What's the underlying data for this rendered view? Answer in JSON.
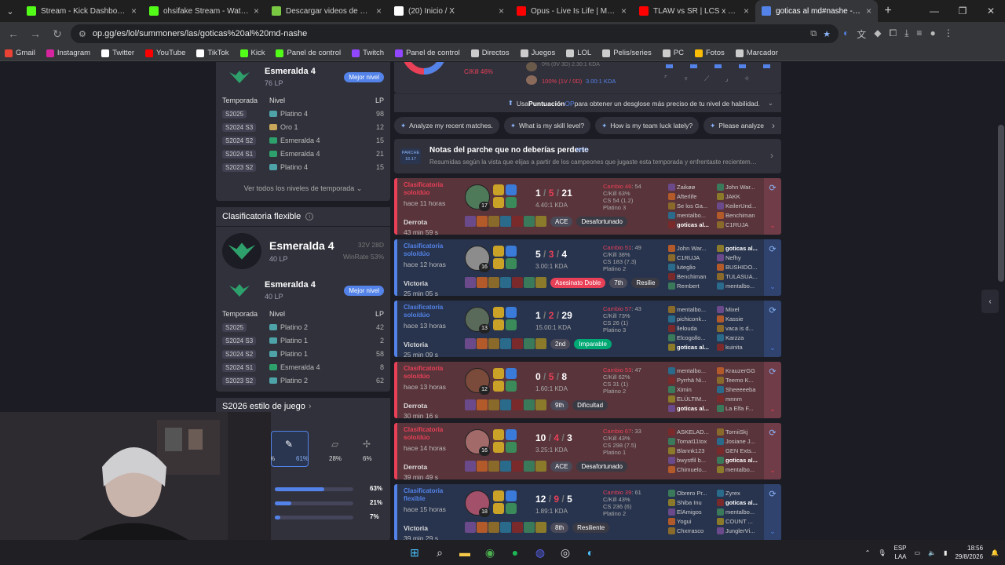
{
  "tabs": [
    {
      "label": "Stream - Kick Dashboard",
      "color": "#53fc18",
      "active": false
    },
    {
      "label": "ohsifake Stream - Watch Live on Kick",
      "color": "#53fc18",
      "active": false
    },
    {
      "label": "Descargar videos de YouTube",
      "color": "#7ac943",
      "active": false
    },
    {
      "label": "(20) Inicio / X",
      "color": "#ffffff",
      "active": false
    },
    {
      "label": "Opus - Live Is Life | Maradona C",
      "color": "#ff0000",
      "active": false
    },
    {
      "label": "TLAW vs SR | LCS x LOL ESPORTS",
      "color": "#ff0000",
      "active": false
    },
    {
      "label": "goticas al md#nashe - Estadísticas",
      "color": "#5383e8",
      "active": true
    }
  ],
  "address": {
    "url": "op.gg/es/lol/summoners/las/goticas%20al%20md-nashe"
  },
  "bookmarks": [
    {
      "label": "Gmail",
      "color": "#ea4335"
    },
    {
      "label": "Instagram",
      "color": "#d6249f"
    },
    {
      "label": "Twitter",
      "color": "#ffffff"
    },
    {
      "label": "YouTube",
      "color": "#ff0000"
    },
    {
      "label": "TikTok",
      "color": "#ffffff"
    },
    {
      "label": "Kick",
      "color": "#53fc18"
    },
    {
      "label": "Panel de control",
      "color": "#53fc18"
    },
    {
      "label": "Twitch",
      "color": "#9146ff"
    },
    {
      "label": "Panel de control",
      "color": "#9146ff"
    },
    {
      "label": "Directos",
      "color": "#cccccc"
    },
    {
      "label": "Juegos",
      "color": "#cccccc"
    },
    {
      "label": "LOL",
      "color": "#cccccc"
    },
    {
      "label": "Pelis/series",
      "color": "#cccccc"
    },
    {
      "label": "PC",
      "color": "#cccccc"
    },
    {
      "label": "Fotos",
      "color": "#fbbc05"
    },
    {
      "label": "Marcador",
      "color": "#cccccc"
    }
  ],
  "solo": {
    "top_rank": "Esmeralda 4",
    "top_lp": "76 LP",
    "best_button": "Mejor nivel",
    "headers": {
      "season": "Temporada",
      "tier": "Nivel",
      "lp": "LP"
    },
    "seasons": [
      {
        "season": "S2025",
        "tier": "Platino 4",
        "lp": "98",
        "color": "#4ea3a8"
      },
      {
        "season": "S2024 S3",
        "tier": "Oro 1",
        "lp": "12",
        "color": "#c8a75a"
      },
      {
        "season": "S2024 S2",
        "tier": "Esmeralda 4",
        "lp": "15",
        "color": "#2ea06b"
      },
      {
        "season": "S2024 S1",
        "tier": "Esmeralda 4",
        "lp": "21",
        "color": "#2ea06b"
      },
      {
        "season": "S2023 S2",
        "tier": "Platino 4",
        "lp": "15",
        "color": "#4ea3a8"
      }
    ],
    "see_all": "Ver todos los niveles de temporada"
  },
  "flex": {
    "title": "Clasificatoria flexible",
    "rank": "Esmeralda 4",
    "lp": "40 LP",
    "record": "32V 28D",
    "winrate": "WinRate 53%",
    "best_rank": "Esmeralda 4",
    "best_lp": "40 LP",
    "best_button": "Mejor nivel",
    "headers": {
      "season": "Temporada",
      "tier": "Nivel",
      "lp": "LP"
    },
    "seasons": [
      {
        "season": "S2025",
        "tier": "Platino 2",
        "lp": "42",
        "color": "#4ea3a8"
      },
      {
        "season": "S2024 S3",
        "tier": "Platino 1",
        "lp": "2",
        "color": "#4ea3a8"
      },
      {
        "season": "S2024 S2",
        "tier": "Platino 1",
        "lp": "58",
        "color": "#4ea3a8"
      },
      {
        "season": "S2024 S1",
        "tier": "Esmeralda 4",
        "lp": "8",
        "color": "#2ea06b"
      },
      {
        "season": "S2023 S2",
        "tier": "Platino 2",
        "lp": "62",
        "color": "#4ea3a8"
      }
    ]
  },
  "playstyle": {
    "title": "S2026 estilo de juego",
    "percents": [
      "%",
      "61%",
      "28%",
      "6%"
    ],
    "bars": [
      {
        "label": "63%",
        "value": 0.63
      },
      {
        "label": "21%",
        "value": 0.21
      },
      {
        "label": "7%",
        "value": 0.07
      }
    ]
  },
  "summary": {
    "ckill": "C/Kill 46%",
    "row1": "0% (0V 3D) 2.30:1 KDA",
    "row2_pct": "100% (1V / 0D)",
    "row2_kda": "3.00:1 KDA"
  },
  "op_score": {
    "pre": "Usa ",
    "highlight": "Puntuación",
    "brand": " OP",
    "post": " para obtener un desglose más preciso de tu nivel de habilidad."
  },
  "ai_chips": [
    "Analyze my recent matches.",
    "What is my skill level?",
    "How is my team luck lately?",
    "Please analyze my rece"
  ],
  "patch": {
    "label_top": "PARCHE",
    "label_bottom": "16.17",
    "title": "Notas del parche que no deberías perderte",
    "beta": "BETA",
    "desc": "Resumidas según la vista que elijas a partir de los campeones que jugaste esta temporada y enfrentaste recientemente..."
  },
  "matches": [
    {
      "result_class": "loss",
      "queue": "Clasificatoria solo/dúo",
      "when": "hace 11 horas",
      "result": "Derrota",
      "length": "43 min 59 s",
      "k": "1",
      "d": "5",
      "a": "21",
      "ratio": "4.40:1 KDA",
      "level": "17",
      "champ_color": "#4f7a5a",
      "lp_change": "Cambio 46",
      "lp_delta": ": 54",
      "ckill": "C/Kill 63%",
      "cs": "CS 54 (1.2)",
      "rank": "Platino 3",
      "badges": [
        {
          "t": "ACE",
          "c": "gray"
        },
        {
          "t": "Desafortunado",
          "c": "dark"
        }
      ],
      "players_left": [
        "Zaikøø",
        "Afterlife",
        "Se los Ga...",
        "mentalbo...",
        "goticas al..."
      ],
      "players_right": [
        "John War...",
        "JAKK",
        "KeilerUnd...",
        "Benchiman",
        "C1RUJA"
      ],
      "me_index": 4
    },
    {
      "result_class": "win",
      "queue": "Clasificatoria solo/dúo",
      "when": "hace 12 horas",
      "result": "Victoria",
      "length": "25 min 05 s",
      "k": "5",
      "d": "3",
      "a": "4",
      "ratio": "3.00:1 KDA",
      "level": "16",
      "champ_color": "#8c8c8c",
      "lp_change": "Cambio 51",
      "lp_delta": ": 49",
      "ckill": "C/Kill 38%",
      "cs": "CS 183 (7.3)",
      "rank": "Platino 2",
      "badges": [
        {
          "t": "Asesinato Doble",
          "c": "red"
        },
        {
          "t": "7th",
          "c": "gray"
        },
        {
          "t": "Resilie",
          "c": "dark"
        }
      ],
      "players_left": [
        "John War...",
        "C1RUJA",
        "luteglio",
        "Benchiman",
        "Rembert"
      ],
      "players_right": [
        "goticas al...",
        "Nefhy",
        "BUSHIDO...",
        "TULASUA...",
        "mentalbo..."
      ],
      "me_index": 5
    },
    {
      "result_class": "win",
      "queue": "Clasificatoria solo/dúo",
      "when": "hace 13 horas",
      "result": "Victoria",
      "length": "25 min 09 s",
      "k": "1",
      "d": "2",
      "a": "29",
      "ratio": "15.00:1 KDA",
      "level": "13",
      "champ_color": "#5a6a5a",
      "lp_change": "Cambio 57",
      "lp_delta": ": 43",
      "ckill": "C/Kill 73%",
      "cs": "CS 26 (1)",
      "rank": "Platino 3",
      "badges": [
        {
          "t": "2nd",
          "c": "gray"
        },
        {
          "t": "Imparable",
          "c": "green"
        }
      ],
      "players_left": [
        "mentalbo...",
        "pichiconk...",
        "llelouda",
        "Elcogollo...",
        "goticas al..."
      ],
      "players_right": [
        "Mixel",
        "Kassie",
        "vaca is d...",
        "Karzza",
        "kuinita"
      ],
      "me_index": 4
    },
    {
      "result_class": "loss",
      "queue": "Clasificatoria solo/dúo",
      "when": "hace 13 horas",
      "result": "Derrota",
      "length": "30 min 16 s",
      "k": "0",
      "d": "5",
      "a": "8",
      "ratio": "1.60:1 KDA",
      "level": "12",
      "champ_color": "#7a4a3a",
      "lp_change": "Cambio 53",
      "lp_delta": ": 47",
      "ckill": "C/Kill 62%",
      "cs": "CS 31 (1)",
      "rank": "Platino 2",
      "badges": [
        {
          "t": "9th",
          "c": "gray"
        },
        {
          "t": "Dificultad",
          "c": "dark"
        }
      ],
      "players_left": [
        "mentalbo...",
        "Pyrrhä Ni...",
        "Ximin",
        "ELÜLTIM...",
        "goticas al..."
      ],
      "players_right": [
        "KrauzerGG",
        "Teemo K...",
        "Sheeeeeba",
        "mnnm",
        "La Elfa F..."
      ],
      "me_index": 4
    },
    {
      "result_class": "loss",
      "queue": "Clasificatoria solo/dúo",
      "when": "hace 14 horas",
      "result": "Derrota",
      "length": "39 min 49 s",
      "k": "10",
      "d": "4",
      "a": "3",
      "ratio": "3.25:1 KDA",
      "level": "16",
      "champ_color": "#a36a6a",
      "lp_change": "Cambio 67",
      "lp_delta": ": 33",
      "ckill": "C/Kill 43%",
      "cs": "CS 298 (7.5)",
      "rank": "Platino 1",
      "badges": [
        {
          "t": "ACE",
          "c": "gray"
        },
        {
          "t": "Desafortunado",
          "c": "dark"
        }
      ],
      "players_left": [
        "ASKELAD...",
        "Tomat11tox",
        "Blannk123",
        "bwystfil b...",
        "Chimuelo..."
      ],
      "players_right": [
        "TorniiSkj",
        "Josiane J...",
        "GEN Exts...",
        "goticas al...",
        "mentalbo..."
      ],
      "me_index": 8
    },
    {
      "result_class": "win",
      "queue": "Clasificatoria flexible",
      "when": "hace 15 horas",
      "result": "Victoria",
      "length": "39 min 29 s",
      "k": "12",
      "d": "9",
      "a": "5",
      "ratio": "1.89:1 KDA",
      "level": "18",
      "champ_color": "#a3506a",
      "lp_change": "Cambio 39",
      "lp_delta": ": 61",
      "ckill": "C/Kill 43%",
      "cs": "CS 236 (6)",
      "rank": "Platino 2",
      "badges": [
        {
          "t": "8th",
          "c": "gray"
        },
        {
          "t": "Resiliente",
          "c": "dark"
        }
      ],
      "players_left": [
        "Obrero Pr...",
        "Shiba Inu",
        "ElAmigos",
        "Yogui",
        "Chxrrasco"
      ],
      "players_right": [
        "Zyrex",
        "goticas al...",
        "mentalbo...",
        "COUNT ...",
        "JunglerVi..."
      ],
      "me_index": 6
    }
  ],
  "taskbar": {
    "lang_top": "ESP",
    "lang_bottom": "LAA",
    "time": "18:56",
    "date": "29/8/2026"
  },
  "colors": {
    "win": "#5383e8",
    "loss": "#e84057",
    "accent": "#5383e8",
    "emerald": "#2ea06b"
  }
}
